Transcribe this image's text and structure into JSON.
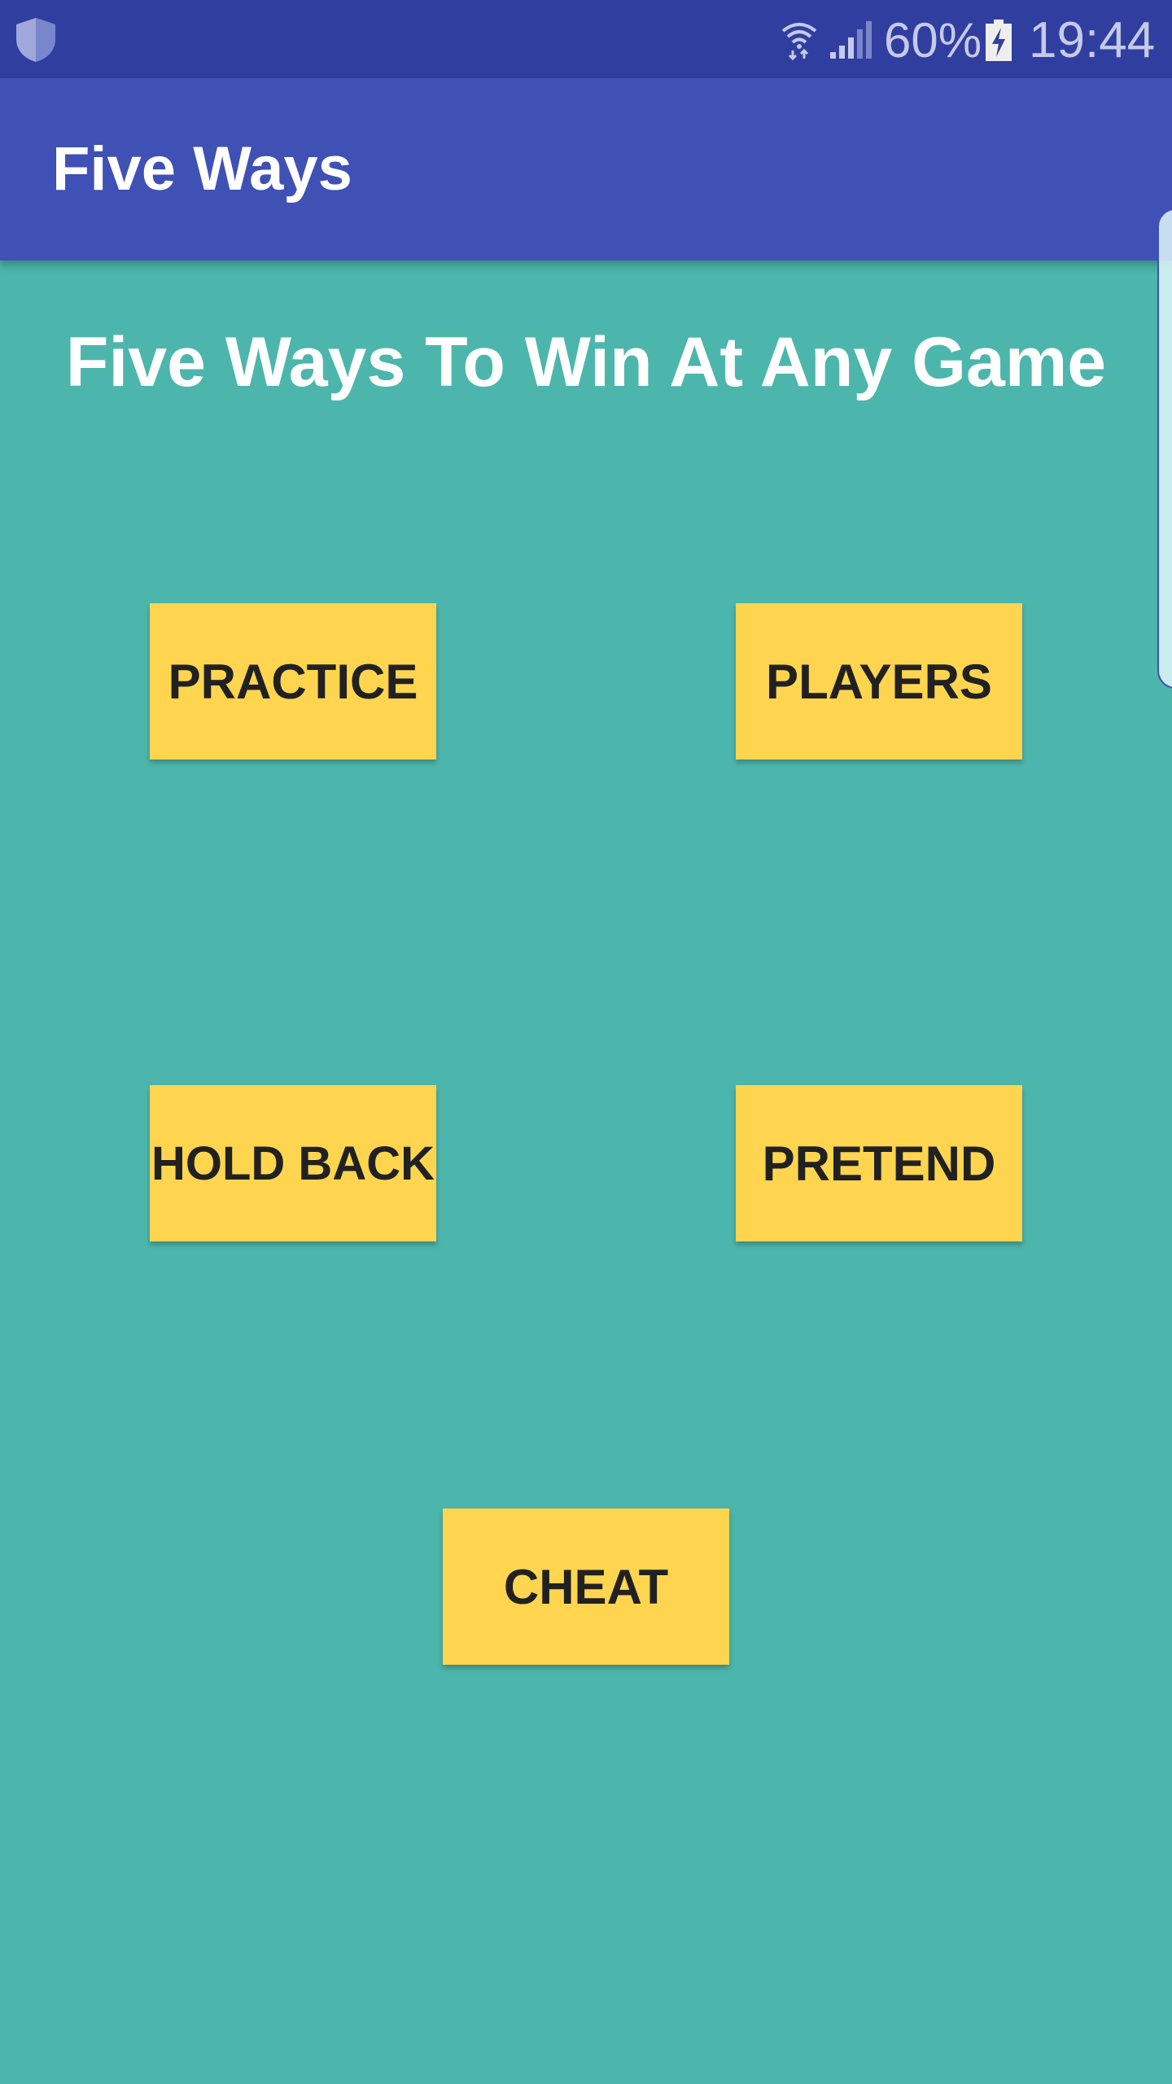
{
  "status_bar": {
    "battery_percent": "60%",
    "time": "19:44",
    "icons": [
      "shield-icon",
      "wifi-icon",
      "signal-icon",
      "battery-charging-icon"
    ]
  },
  "app_bar": {
    "title": "Five Ways"
  },
  "main": {
    "heading": "Five Ways To Win At Any Game",
    "buttons": {
      "practice": "PRACTICE",
      "players": "PLAYERS",
      "hold_back": "HOLD BACK",
      "pretend": "PRETEND",
      "cheat": "CHEAT"
    }
  },
  "colors": {
    "status_bar": "#303F9F",
    "app_bar": "#3F51B5",
    "background": "#4DB6AC",
    "button": "#FFD54F",
    "button_text": "#212121"
  }
}
